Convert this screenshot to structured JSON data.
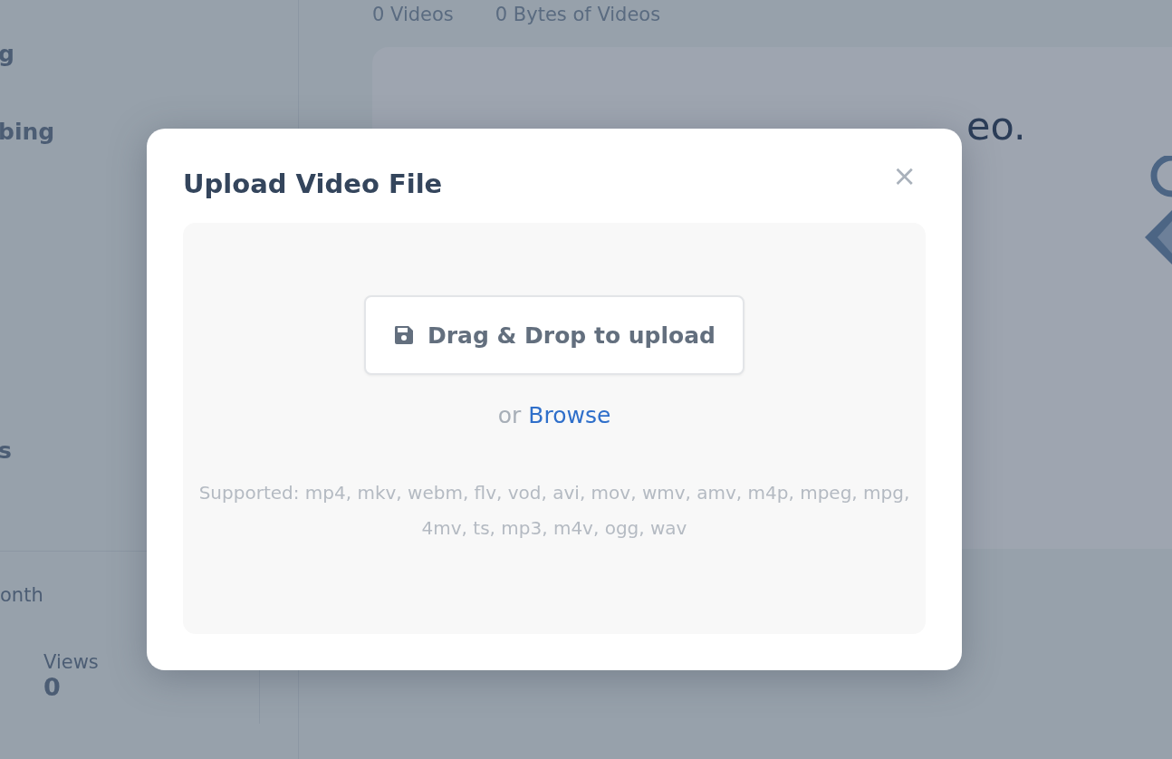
{
  "sidebar": {
    "items": [
      {
        "label": "g"
      },
      {
        "label": "bing"
      },
      {
        "label": "s"
      }
    ],
    "stats": {
      "period": "onth",
      "metric_label": "Views",
      "metric_value": "0"
    }
  },
  "summary": {
    "videos": "0 Videos",
    "bytes": "0 Bytes of Videos"
  },
  "empty_state": {
    "headline": "eo."
  },
  "modal": {
    "title": "Upload Video File",
    "close": "×",
    "dropzone": {
      "button": "Drag & Drop to upload",
      "or": "or",
      "browse": "Browse",
      "supported": "Supported: mp4, mkv, webm, flv, vod, avi, mov, wmv, amv, m4p, mpeg, mpg, 4mv, ts, mp3, m4v, ogg, wav"
    }
  }
}
